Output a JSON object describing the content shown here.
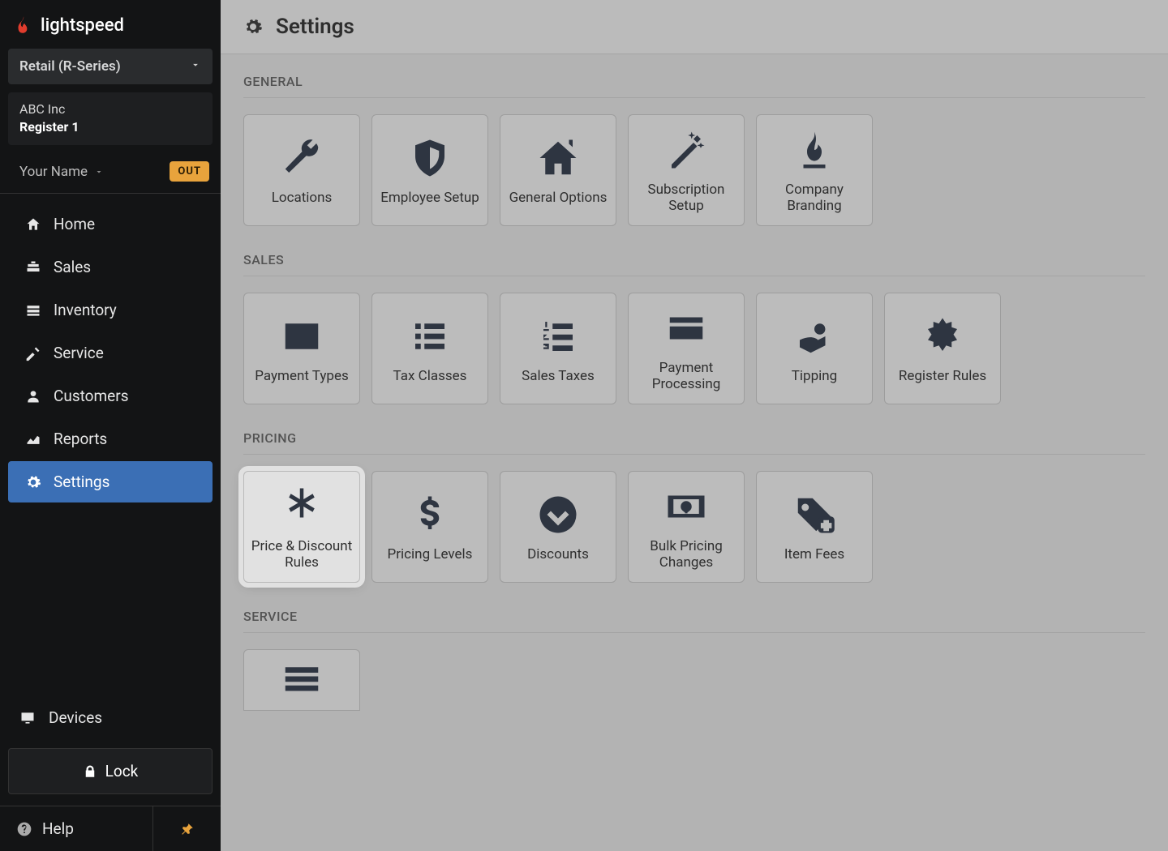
{
  "brand": "lightspeed",
  "product_selector": "Retail (R-Series)",
  "company": "ABC Inc",
  "register": "Register 1",
  "user_name": "Your Name",
  "out_badge": "OUT",
  "nav": [
    {
      "label": "Home"
    },
    {
      "label": "Sales"
    },
    {
      "label": "Inventory"
    },
    {
      "label": "Service"
    },
    {
      "label": "Customers"
    },
    {
      "label": "Reports"
    },
    {
      "label": "Settings"
    }
  ],
  "devices_label": "Devices",
  "lock_label": "Lock",
  "help_label": "Help",
  "page_title": "Settings",
  "sections": {
    "general": {
      "title": "GENERAL",
      "tiles": [
        "Locations",
        "Employee Setup",
        "General Options",
        "Subscription Setup",
        "Company Branding"
      ]
    },
    "sales": {
      "title": "SALES",
      "tiles": [
        "Payment Types",
        "Tax Classes",
        "Sales Taxes",
        "Payment Processing",
        "Tipping",
        "Register Rules"
      ]
    },
    "pricing": {
      "title": "PRICING",
      "tiles": [
        "Price & Discount Rules",
        "Pricing Levels",
        "Discounts",
        "Bulk Pricing Changes",
        "Item Fees"
      ]
    },
    "service": {
      "title": "SERVICE"
    }
  }
}
